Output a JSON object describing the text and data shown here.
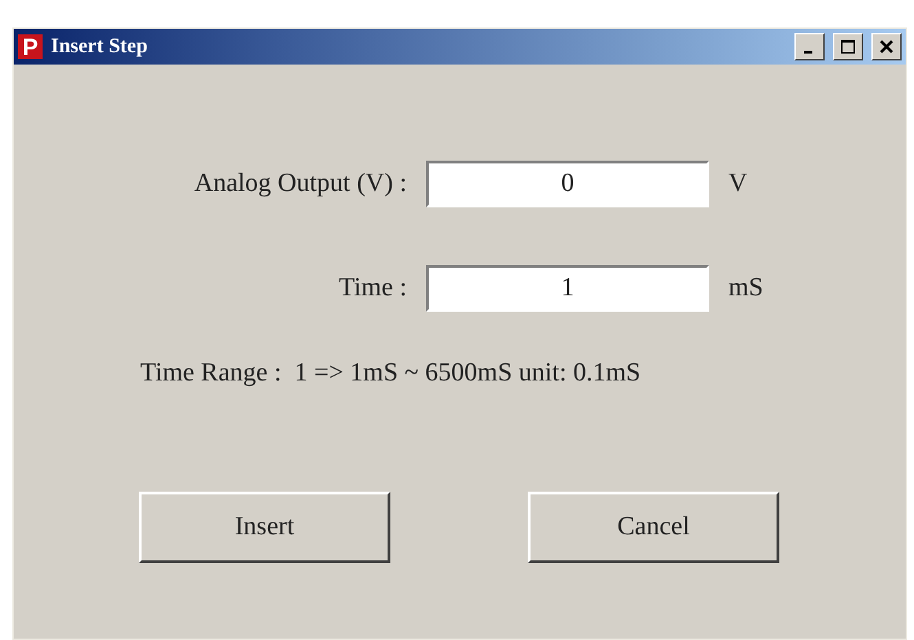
{
  "window": {
    "title": "Insert Step",
    "app_icon_letter": "P"
  },
  "fields": [
    {
      "label": "Analog Output (V) :",
      "value": "0",
      "unit": "V"
    },
    {
      "label": "Time :",
      "value": "1",
      "unit": "mS"
    }
  ],
  "note": "Time Range :  1 => 1mS ~ 6500mS unit: 0.1mS",
  "buttons": [
    "Insert",
    "Cancel"
  ]
}
